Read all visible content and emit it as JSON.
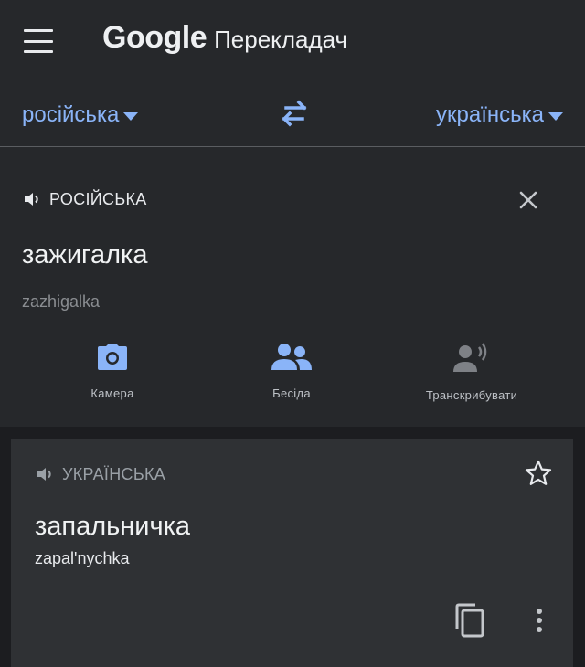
{
  "app": {
    "brand": "Google",
    "product": "Перекладач"
  },
  "languages": {
    "source": "російська",
    "target": "українська"
  },
  "input": {
    "label": "РОСІЙСЬКА",
    "text": "зажигалка",
    "transliteration": "zazhigalka"
  },
  "tools": [
    {
      "label": "Камера",
      "icon": "camera-icon"
    },
    {
      "label": "Бесіда",
      "icon": "people-icon"
    },
    {
      "label": "Транскрибувати",
      "icon": "transcribe-icon"
    }
  ],
  "output": {
    "label": "УКРАЇНСЬКА",
    "text": "запальничка",
    "transliteration": "zapalʹnychka"
  },
  "colors": {
    "accent": "#8ab4f8",
    "background": "#1c1d20",
    "surface": "#26282b",
    "output_surface": "#2f3134"
  }
}
